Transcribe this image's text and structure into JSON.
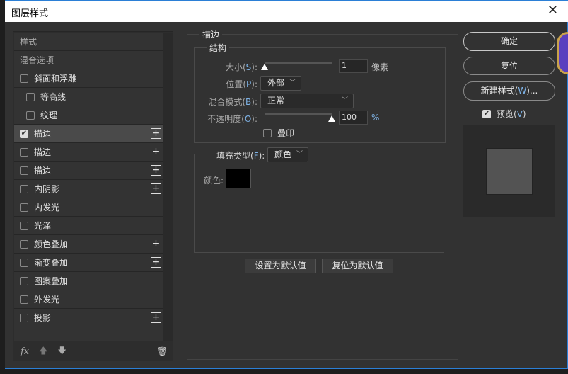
{
  "window": {
    "title": "图层样式",
    "close": "✕"
  },
  "sidebar": {
    "items": [
      {
        "label": "样式",
        "type": "header"
      },
      {
        "label": "混合选项",
        "type": "header"
      },
      {
        "label": "斜面和浮雕",
        "checked": false,
        "indent": false,
        "plus": false
      },
      {
        "label": "等高线",
        "checked": false,
        "indent": true,
        "plus": false
      },
      {
        "label": "纹理",
        "checked": false,
        "indent": true,
        "plus": false
      },
      {
        "label": "描边",
        "checked": true,
        "indent": false,
        "plus": true,
        "selected": true
      },
      {
        "label": "描边",
        "checked": false,
        "indent": false,
        "plus": true
      },
      {
        "label": "描边",
        "checked": false,
        "indent": false,
        "plus": true
      },
      {
        "label": "内阴影",
        "checked": false,
        "indent": false,
        "plus": true
      },
      {
        "label": "内发光",
        "checked": false,
        "indent": false,
        "plus": false
      },
      {
        "label": "光泽",
        "checked": false,
        "indent": false,
        "plus": false
      },
      {
        "label": "颜色叠加",
        "checked": false,
        "indent": false,
        "plus": true
      },
      {
        "label": "渐变叠加",
        "checked": false,
        "indent": false,
        "plus": true
      },
      {
        "label": "图案叠加",
        "checked": false,
        "indent": false,
        "plus": false
      },
      {
        "label": "外发光",
        "checked": false,
        "indent": false,
        "plus": false
      },
      {
        "label": "投影",
        "checked": false,
        "indent": false,
        "plus": true
      }
    ],
    "footer": {
      "fx": "fx"
    }
  },
  "stroke": {
    "title": "描边",
    "structure": {
      "title": "结构",
      "size_label": "大小",
      "size_key": "S",
      "size_value": "1",
      "size_unit": "像素",
      "size_fraction": 0.0,
      "position_label": "位置",
      "position_key": "P",
      "position_value": "外部",
      "blend_label": "混合模式",
      "blend_key": "B",
      "blend_value": "正常",
      "opacity_label": "不透明度",
      "opacity_key": "O",
      "opacity_value": "100",
      "opacity_unit": "%",
      "opacity_fraction": 1.0,
      "overprint_label": "叠印",
      "overprint_checked": false
    },
    "fill": {
      "type_label": "填充类型",
      "type_key": "F",
      "type_value": "颜色",
      "color_label": "颜色:",
      "color": "#000000"
    },
    "set_default": "设置为默认值",
    "reset_default": "复位为默认值"
  },
  "actions": {
    "ok": "确定",
    "reset": "复位",
    "new_style": "新建样式",
    "new_style_key": "W",
    "new_style_suffix": "...",
    "preview_label": "预览",
    "preview_key": "V",
    "preview_checked": true
  },
  "colors": {
    "accent": "#2b7fd6",
    "preview_swatch": "#535353"
  }
}
